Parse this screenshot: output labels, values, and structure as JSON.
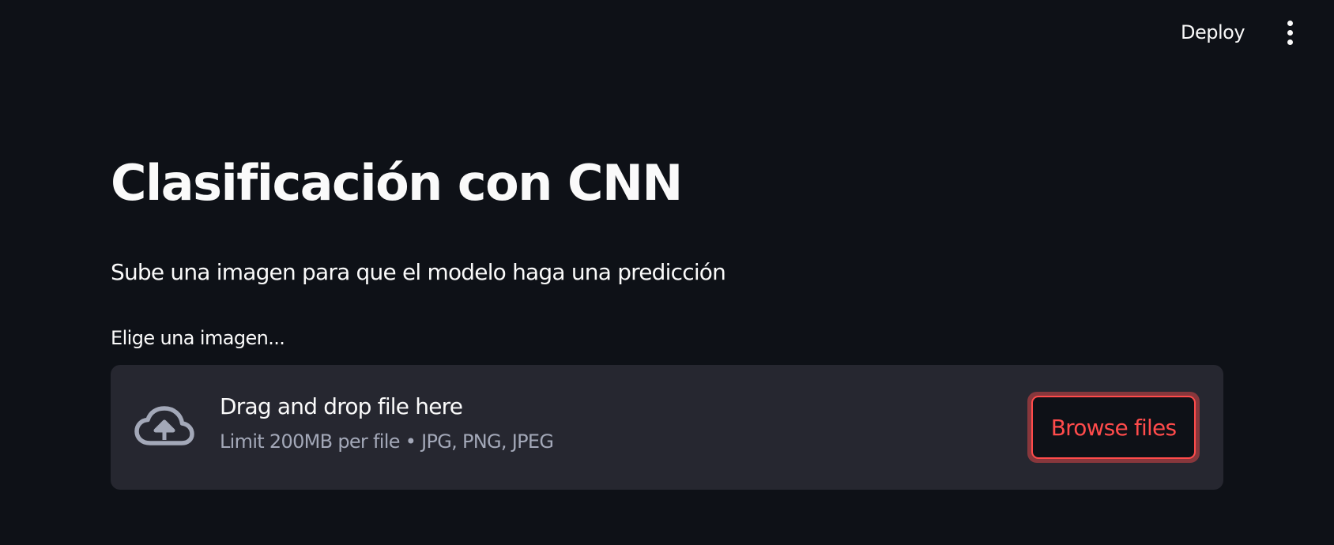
{
  "header": {
    "deploy_label": "Deploy",
    "menu_icon": "vertical-ellipsis-icon"
  },
  "main": {
    "title": "Clasificación con CNN",
    "subtitle": "Sube una imagen para que el modelo haga una predicción",
    "uploader": {
      "label": "Elige una imagen...",
      "dropzone_title": "Drag and drop file here",
      "dropzone_limit": "Limit 200MB per file • JPG, PNG, JPEG",
      "browse_label": "Browse files",
      "icon": "cloud-upload-icon"
    }
  },
  "colors": {
    "background": "#0e1117",
    "dropzone_bg": "#262730",
    "text": "#fafafa",
    "muted_text": "#a3a8b8",
    "accent": "#ff4b4b"
  }
}
